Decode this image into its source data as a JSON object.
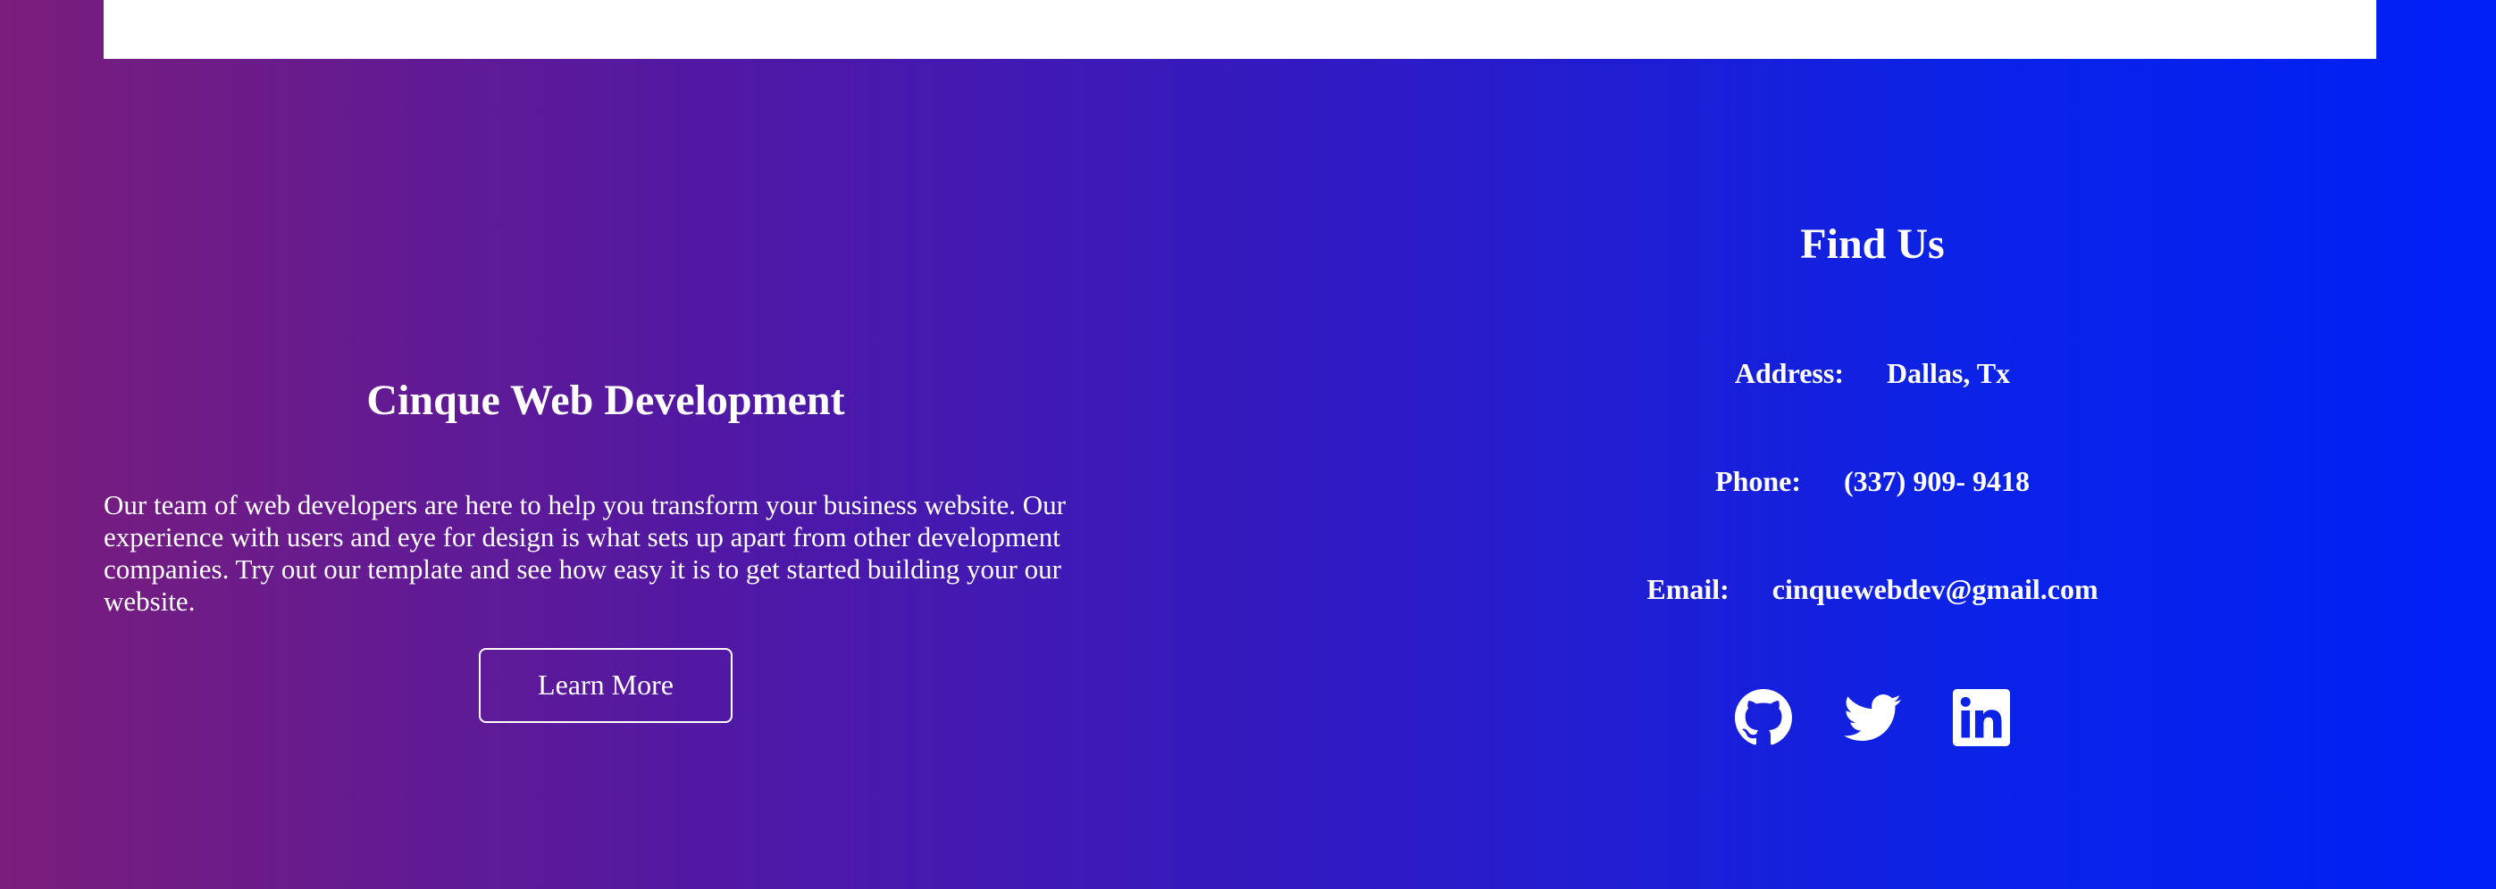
{
  "about": {
    "title": "Cinque Web Development",
    "description": "Our team of web developers are here to help you transform your business website. Our experience with users and eye for design is what sets up apart from other development companies. Try out our template and see how easy it is to get started building your our website.",
    "button_label": "Learn More"
  },
  "contact": {
    "title": "Find Us",
    "address_label": "Address:",
    "address_value": "Dallas, Tx",
    "phone_label": "Phone:",
    "phone_value": "(337) 909- 9418",
    "email_label": "Email:",
    "email_value": "cinquewebdev@gmail.com"
  },
  "social": [
    "github-icon",
    "twitter-icon",
    "linkedin-icon"
  ],
  "colors": {
    "gradient_start": "#7a1d7c",
    "gradient_end": "#0020f7",
    "text": "#ffffff",
    "top_bar": "#ffffff"
  }
}
